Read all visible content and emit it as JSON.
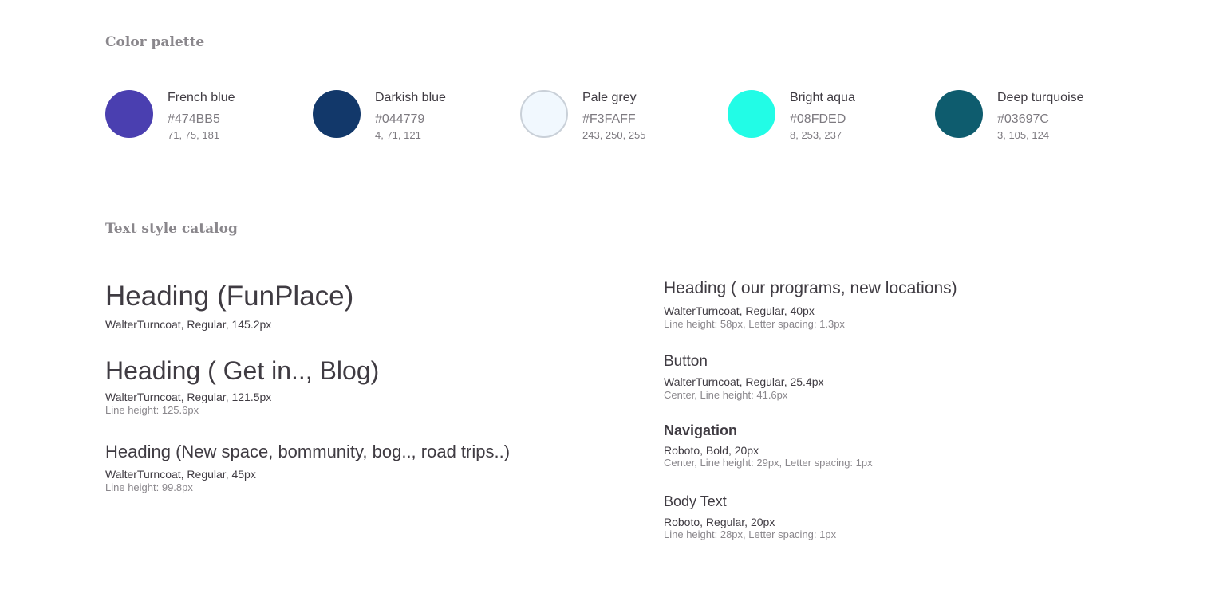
{
  "palette": {
    "title": "Color palette",
    "colors": [
      {
        "name": "French blue",
        "hex": "#474BB5",
        "rgb": "71, 75, 181",
        "swatch": "#4A3FB0"
      },
      {
        "name": "Darkish blue",
        "hex": "#044779",
        "rgb": "4, 71, 121",
        "swatch": "#12386A"
      },
      {
        "name": "Pale grey",
        "hex": "#F3FAFF",
        "rgb": "243, 250, 255",
        "swatch": "#F1F8FE"
      },
      {
        "name": "Bright aqua",
        "hex": "#08FDED",
        "rgb": "8, 253, 237",
        "swatch": "#22FCE6"
      },
      {
        "name": "Deep turquoise",
        "hex": "#03697C",
        "rgb": "3, 105, 124",
        "swatch": "#0E5C6E"
      }
    ]
  },
  "catalog": {
    "title": "Text style catalog",
    "styles": [
      {
        "sample": "Heading (FunPlace)",
        "spec": "WalterTurncoat, Regular, 145.2px",
        "note": ""
      },
      {
        "sample": "Heading ( Get in.., Blog)",
        "spec": "WalterTurncoat, Regular, 121.5px",
        "note": "Line height: 125.6px"
      },
      {
        "sample": "Heading (New space, bommunity, bog.., road trips..)",
        "spec": "WalterTurncoat, Regular, 45px",
        "note": "Line height: 99.8px"
      },
      {
        "sample": "Heading ( our programs, new locations)",
        "spec": "WalterTurncoat, Regular, 40px",
        "note": "Line height: 58px, Letter spacing: 1.3px"
      },
      {
        "sample": "Button",
        "spec": "WalterTurncoat, Regular, 25.4px",
        "note": "Center, Line height: 41.6px"
      },
      {
        "sample": "Navigation",
        "spec": "Roboto, Bold, 20px",
        "note": "Center, Line height: 29px, Letter spacing: 1px"
      },
      {
        "sample": "Body Text",
        "spec": "Roboto, Regular, 20px",
        "note": "Line height: 28px, Letter spacing: 1px"
      }
    ]
  }
}
